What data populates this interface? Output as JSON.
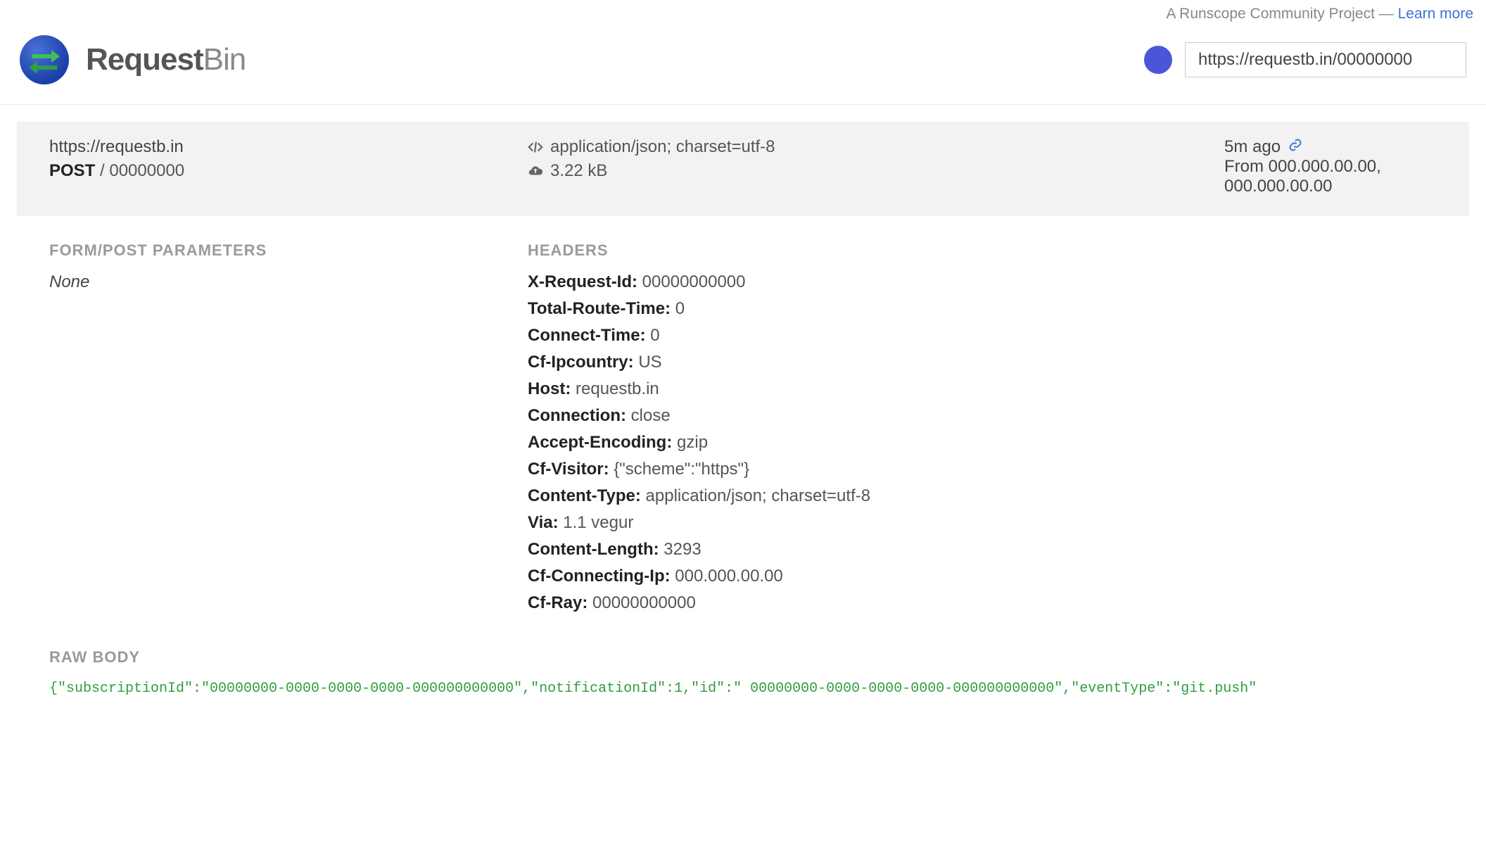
{
  "topbar": {
    "tagline": "A Runscope Community Project — ",
    "learn_more": "Learn more"
  },
  "brand": {
    "part1": "Request",
    "part2": "Bin"
  },
  "bin_url": "https://requestb.in/00000000",
  "summary": {
    "host": "https://requestb.in",
    "method": "POST",
    "path": "/ 00000000",
    "content_type": "application/json; charset=utf-8",
    "size": "3.22 kB",
    "time_ago": "5m ago",
    "from_label": "From",
    "from_ips": "000.000.00.00, 000.000.00.00"
  },
  "sections": {
    "form_params_title": "FORM/POST PARAMETERS",
    "form_params_value": "None",
    "headers_title": "HEADERS",
    "raw_body_title": "RAW BODY"
  },
  "headers": [
    {
      "k": "X-Request-Id",
      "v": "00000000000"
    },
    {
      "k": "Total-Route-Time",
      "v": "0"
    },
    {
      "k": "Connect-Time",
      "v": "0"
    },
    {
      "k": "Cf-Ipcountry",
      "v": "US"
    },
    {
      "k": "Host",
      "v": "requestb.in"
    },
    {
      "k": "Connection",
      "v": "close"
    },
    {
      "k": "Accept-Encoding",
      "v": "gzip"
    },
    {
      "k": "Cf-Visitor",
      "v": "{\"scheme\":\"https\"}"
    },
    {
      "k": "Content-Type",
      "v": "application/json; charset=utf-8"
    },
    {
      "k": "Via",
      "v": "1.1 vegur"
    },
    {
      "k": "Content-Length",
      "v": "3293"
    },
    {
      "k": "Cf-Connecting-Ip",
      "v": "000.000.00.00"
    },
    {
      "k": "Cf-Ray",
      "v": "00000000000"
    }
  ],
  "raw_body": "{\"subscriptionId\":\"00000000-0000-0000-0000-000000000000\",\"notificationId\":1,\"id\":\" 00000000-0000-0000-0000-000000000000\",\"eventType\":\"git.push\""
}
